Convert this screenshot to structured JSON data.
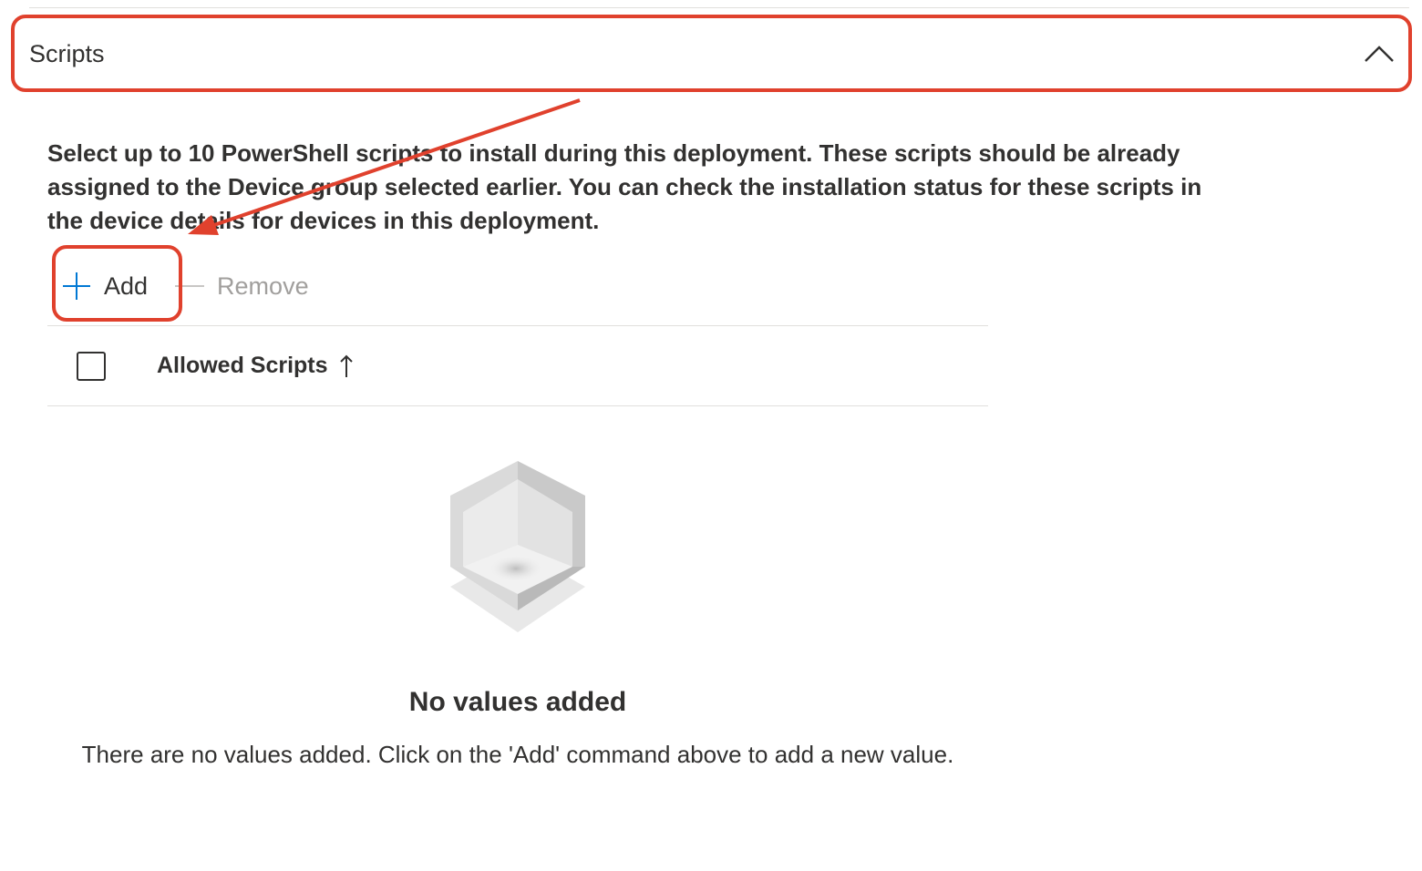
{
  "section": {
    "title": "Scripts",
    "toggle_icon": "chevron-up-icon",
    "expanded": true
  },
  "description": "Select up to 10 PowerShell scripts to install during this deployment. These scripts should be already assigned to the Device group selected earlier. You can check the installation status for these scripts in the device details for devices in this deployment.",
  "commands": {
    "add_label": "Add",
    "add_icon": "plus-icon",
    "remove_label": "Remove",
    "remove_icon": "minus-icon",
    "remove_enabled": false
  },
  "table": {
    "columns": [
      {
        "label": "Allowed Scripts",
        "sort": "ascending",
        "sort_icon": "arrow-up-icon"
      }
    ],
    "select_all_checked": false,
    "rows": []
  },
  "empty_state": {
    "illustration": "empty-box-icon",
    "title": "No values added",
    "message": "There are no values added. Click on the 'Add' command above to add a new value."
  },
  "colors": {
    "annotation": "#e0412d",
    "accent": "#0078d4",
    "text": "#323130",
    "disabled_text": "#a19f9d",
    "divider": "#e1dfdd"
  }
}
